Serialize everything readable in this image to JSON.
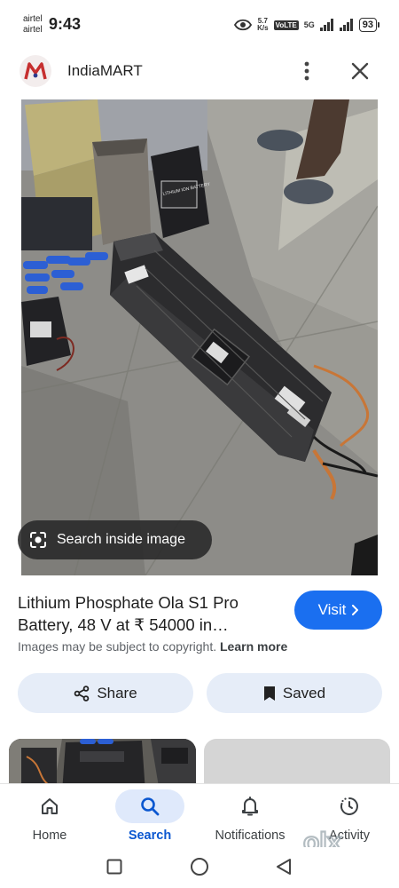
{
  "status_bar": {
    "carrier_1": "airtel",
    "carrier_2": "airtel",
    "time": "9:43",
    "net_speed_value": "5.7",
    "net_speed_unit": "K/s",
    "volte": "VoLTE",
    "network": "5G",
    "battery": "93"
  },
  "header": {
    "site_name": "IndiaMART",
    "logo_letter": "M",
    "icons": {
      "more": "more-vert-icon",
      "close": "close-icon"
    }
  },
  "image": {
    "lens_label": "Search inside image",
    "battery_label": "LITHIUM ION BATTERY"
  },
  "result": {
    "title": "Lithium Phosphate Ola S1 Pro Battery, 48 V at ₹ 54000 in…",
    "visit_label": "Visit",
    "copyright_text": "Images may be subject to copyright.",
    "learn_more": "Learn more"
  },
  "actions": {
    "share_label": "Share",
    "saved_label": "Saved"
  },
  "bottom_nav": {
    "items": [
      {
        "label": "Home",
        "icon": "home-icon"
      },
      {
        "label": "Search",
        "icon": "search-icon",
        "active": true
      },
      {
        "label": "Notifications",
        "icon": "bell-icon"
      },
      {
        "label": "Activity",
        "icon": "activity-icon"
      }
    ]
  },
  "watermark": {
    "brand": "olx"
  },
  "colors": {
    "accent": "#1a6ff0",
    "pill_bg": "#e6edf8",
    "active_nav": "#0b57d0",
    "logo_red": "#c62f2f"
  }
}
